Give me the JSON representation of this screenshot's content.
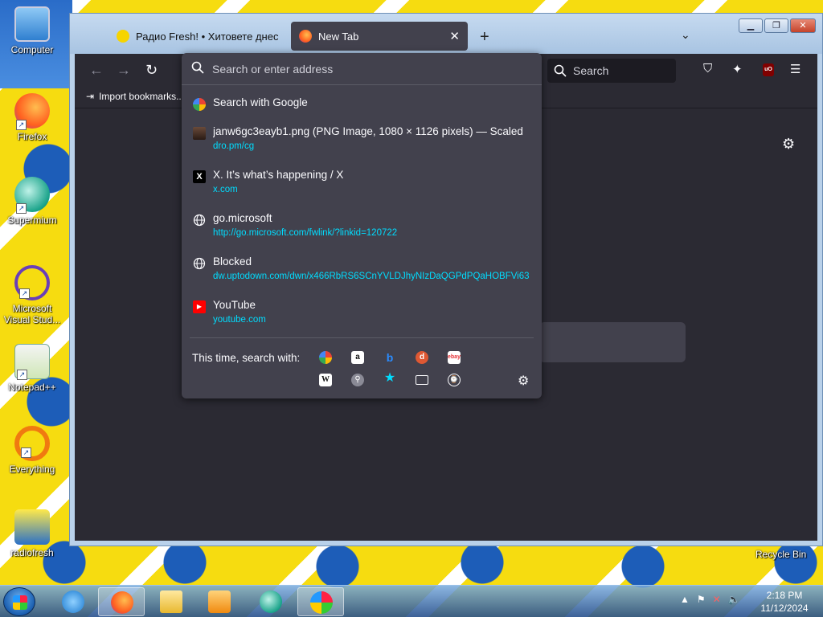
{
  "desktop": {
    "icons": [
      {
        "label": "Computer"
      },
      {
        "label": "Firefox"
      },
      {
        "label": "Supermium"
      },
      {
        "label": "Microsoft Visual Stud..."
      },
      {
        "label": "Notepad++"
      },
      {
        "label": "Everything"
      },
      {
        "label": "radiofresh"
      }
    ],
    "recycle_bin": "Recycle Bin"
  },
  "browser": {
    "tabs": [
      {
        "title": "Радио Fresh! • Хитовете днес",
        "active": false
      },
      {
        "title": "New Tab",
        "active": true
      }
    ],
    "search_placeholder": "Search",
    "bookmarks_toolbar": {
      "import_label": "Import bookmarks..."
    },
    "urlbar": {
      "placeholder": "Search or enter address",
      "value": "",
      "results": [
        {
          "title": "Search with Google",
          "url": "",
          "icon": "google-icon"
        },
        {
          "title": "janw6gc3eayb1.png (PNG Image, 1080 × 1126 pixels) — Scaled",
          "url": "dro.pm/cg",
          "icon": "image-icon"
        },
        {
          "title": "X. It’s what’s happening / X",
          "url": "x.com",
          "icon": "x-icon"
        },
        {
          "title": "go.microsoft",
          "url": "http://go.microsoft.com/fwlink/?linkid=120722",
          "icon": "globe-icon"
        },
        {
          "title": "Blocked",
          "url": "dw.uptodown.com/dwn/x466RbRS6SCnYVLDJhyNIzDaQGPdPQaHOBFVi63",
          "icon": "globe-icon"
        },
        {
          "title": "YouTube",
          "url": "youtube.com",
          "icon": "youtube-icon"
        }
      ],
      "oneoff_label": "This time, search with:"
    }
  },
  "taskbar": {
    "time": "2:18 PM",
    "date": "11/12/2024"
  },
  "colors": {
    "browser_bg": "#2b2a33",
    "popup_bg": "#42414d",
    "url_link": "#00ddff"
  }
}
